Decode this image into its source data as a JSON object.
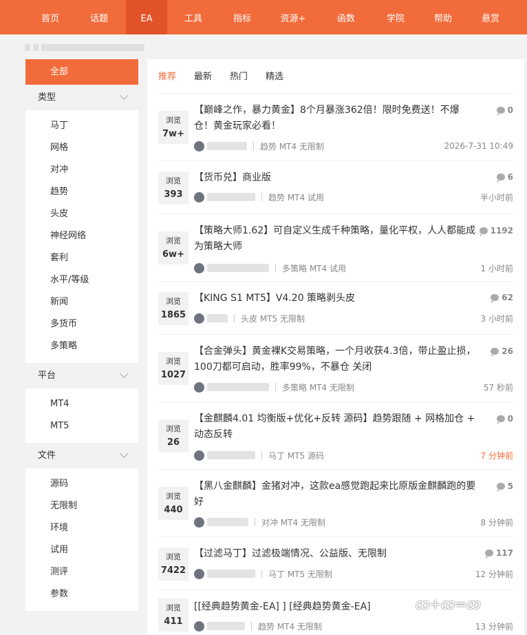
{
  "nav": [
    {
      "label": "首页",
      "active": false
    },
    {
      "label": "话题",
      "active": false
    },
    {
      "label": "EA",
      "active": true
    },
    {
      "label": "工具",
      "active": false
    },
    {
      "label": "指标",
      "active": false
    },
    {
      "label": "资源+",
      "active": false
    },
    {
      "label": "函数",
      "active": false
    },
    {
      "label": "学院",
      "active": false
    },
    {
      "label": "帮助",
      "active": false
    },
    {
      "label": "悬赏",
      "active": false
    }
  ],
  "sidebar": {
    "all_label": "全部",
    "groups": [
      {
        "title": "类型",
        "items": [
          "马丁",
          "网格",
          "对冲",
          "趋势",
          "头皮",
          "神经网络",
          "套利",
          "水平/等级",
          "新闻",
          "多货币",
          "多策略"
        ]
      },
      {
        "title": "平台",
        "items": [
          "MT4",
          "MT5"
        ]
      },
      {
        "title": "文件",
        "items": [
          "源码",
          "无限制",
          "环境",
          "试用",
          "测评",
          "参数"
        ]
      }
    ]
  },
  "tabs": [
    "推荐",
    "最新",
    "热门",
    "精选"
  ],
  "posts": [
    {
      "views_label": "浏览",
      "views": "7w+",
      "title": "【巅峰之作，暴力黄金】8个月暴涨362倍！限时免费送！不爆仓！黄金玩家必看！",
      "comments": "0",
      "tags": "趋势 MT4 无限制",
      "time": "2026-7-31 10:49",
      "hot": false
    },
    {
      "views_label": "浏览",
      "views": "393",
      "title": "【货币兑】商业版",
      "comments": "6",
      "tags": "趋势 MT4 试用",
      "time": "半小时前",
      "hot": false
    },
    {
      "views_label": "浏览",
      "views": "6w+",
      "title": "【策略大师1.62】可自定义生成千种策略，量化平权，人人都能成为策略大师",
      "comments": "1192",
      "tags": "多策略 MT4 试用",
      "time": "1 小时前",
      "hot": false
    },
    {
      "views_label": "浏览",
      "views": "1865",
      "title": "【KING S1 MT5】V4.20 策略剥头皮",
      "comments": "62",
      "tags": "头皮 MT5 无限制",
      "time": "3 小时前",
      "hot": false
    },
    {
      "views_label": "浏览",
      "views": "1027",
      "title": "【合金弹头】黄金裸K交易策略，一个月收获4.3倍，带止盈止损，100刀都可启动，胜率99%，不暴仓 关闭",
      "comments": "26",
      "tags": "多策略 MT4 无限制",
      "time": "57 秒前",
      "hot": false
    },
    {
      "views_label": "浏览",
      "views": "26",
      "title": "【金麒麟4.01 均衡版+优化+反转 源码】趋势跟随 + 网格加仓 + 动态反转",
      "comments": "0",
      "tags": "马丁 MT5 源码",
      "time": "7 分钟前",
      "hot": true
    },
    {
      "views_label": "浏览",
      "views": "440",
      "title": "【黑八金麒麟】金猪对冲，这款ea感觉跑起来比原版金麒麟跑的要好",
      "comments": "5",
      "tags": "对冲 MT4 无限制",
      "time": "8 分钟前",
      "hot": false
    },
    {
      "views_label": "浏览",
      "views": "7422",
      "title": "【过滤马丁】过滤极端情况、公益版、无限制",
      "comments": "117",
      "tags": "马丁 MT5 无限制",
      "time": "12 分钟前",
      "hot": false
    },
    {
      "views_label": "浏览",
      "views": "411",
      "title": "[[经典趋势黄金-EA] ] [经典趋势黄金-EA]",
      "comments": "",
      "tags": "趋势 MT4 无限制",
      "time": "13 分钟前",
      "hot": false
    }
  ],
  "watermark": "ꝏ+ꝏ=ꝏ"
}
